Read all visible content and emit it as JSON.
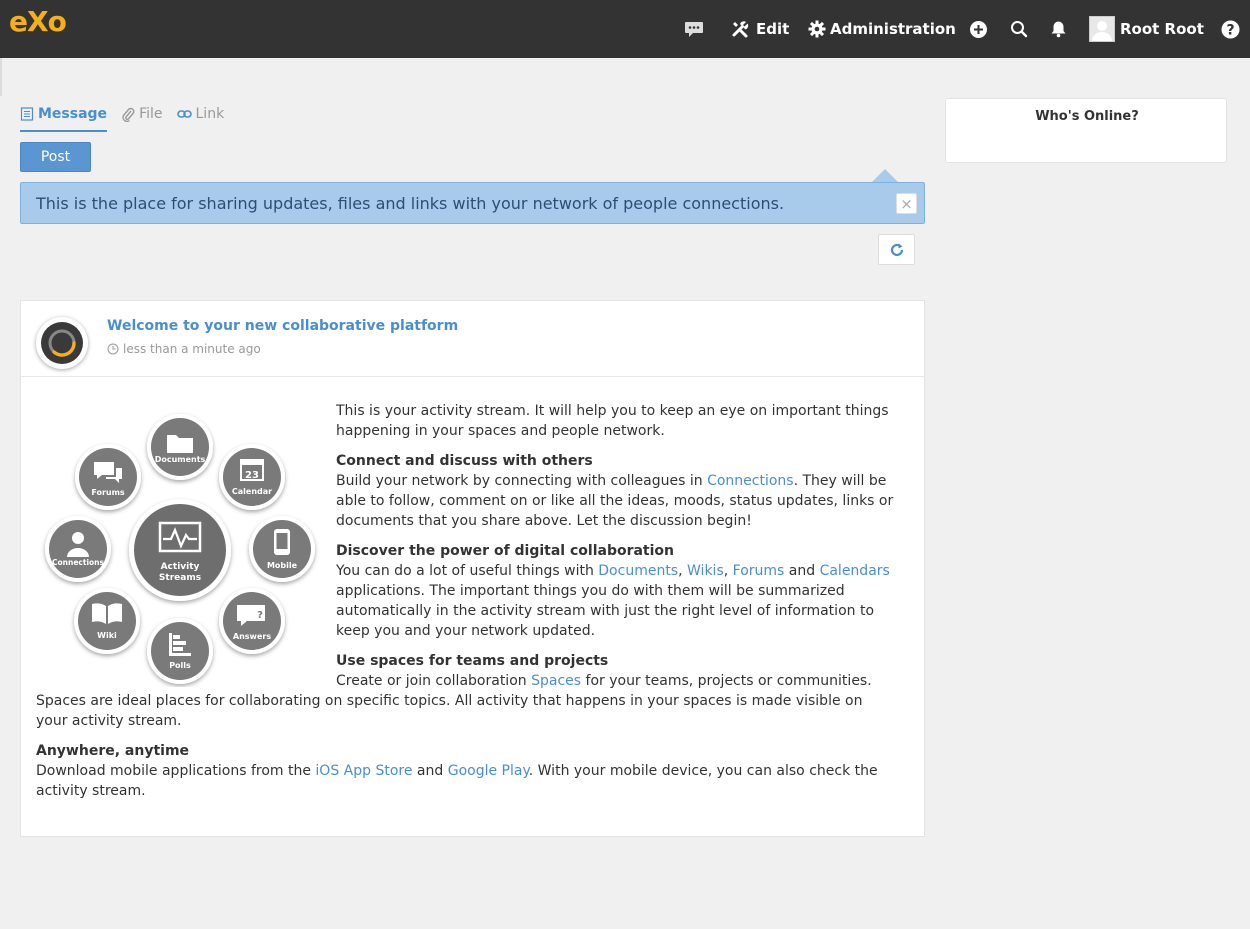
{
  "topbar": {
    "logo": "eXo",
    "edit_label": "Edit",
    "admin_label": "Administration",
    "user_name": "Root Root",
    "icons": [
      "chat-icon",
      "edit-tools-icon",
      "gear-icon",
      "plus-circle-icon",
      "search-icon",
      "bell-icon",
      "help-icon"
    ]
  },
  "composer": {
    "tabs": [
      {
        "label": "Message",
        "icon": "document-icon",
        "active": true
      },
      {
        "label": "File",
        "icon": "paperclip-icon",
        "active": false
      },
      {
        "label": "Link",
        "icon": "link-icon",
        "active": false
      }
    ],
    "post_label": "Post"
  },
  "info": {
    "text": "This is the place for sharing updates, files and links with your network of people connections.",
    "close": "×"
  },
  "activity": {
    "title": "Welcome to your new collaborative platform",
    "time": "less than a minute ago",
    "illustration_labels": {
      "documents": "Documents",
      "calendar": "Calendar",
      "calendar_day": "23",
      "forums": "Forums",
      "mobile": "Mobile",
      "connections": "Connections",
      "activity": "Activity",
      "streams": "Streams",
      "answers": "Answers",
      "wiki": "Wiki",
      "polls": "Polls"
    },
    "intro": "This is your activity stream. It will help you to keep an eye on important things happening in your spaces and people network.",
    "s1_title": "Connect and discuss with others",
    "s1_a": "Build your network by connecting with colleagues in ",
    "s1_link": "Connections",
    "s1_b": ". They will be able to follow, comment on or like all the ideas, moods, status updates, links or documents that you share above. Let the discussion begin!",
    "s2_title": "Discover the power of digital collaboration",
    "s2_a": "You can do a lot of useful things with ",
    "s2_link1": "Documents",
    "s2_sep1": ", ",
    "s2_link2": "Wikis",
    "s2_sep2": ", ",
    "s2_link3": "Forums",
    "s2_and": " and ",
    "s2_link4": "Calendars",
    "s2_b": " applications. The important things you do with them will be summarized automatically in the activity stream with just the right level of information to keep you and your network updated.",
    "s3_title": "Use spaces for teams and projects",
    "s3_a": "Create or join collaboration ",
    "s3_link": "Spaces",
    "s3_b": " for your teams, projects or communities. Spaces are ideal places for collaborating on specific topics. All activity that happens in your spaces is made visible on your activity stream.",
    "s4_title": "Anywhere, anytime",
    "s4_a": "Download mobile applications from the ",
    "s4_link1": "iOS App Store",
    "s4_and": " and ",
    "s4_link2": "Google Play",
    "s4_b": ". With your mobile device, you can also check the activity stream."
  },
  "online": {
    "title": "Who's Online?"
  },
  "colors": {
    "topbar": "#333333",
    "accent": "#4a8ed0",
    "logo": "#f5b018",
    "info_bg": "#a9cbeb"
  }
}
